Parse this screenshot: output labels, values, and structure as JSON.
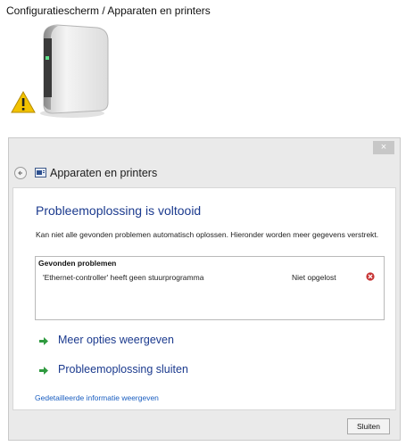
{
  "breadcrumb": "Configuratiescherm / Apparaten en printers",
  "device": {
    "icon": "network-adapter-warning-icon"
  },
  "dialog": {
    "close_label": "×",
    "nav_title": "Apparaten en printers",
    "heading": "Probleemoplossing is voltooid",
    "description": "Kan niet alle gevonden problemen automatisch oplossen. Hieronder worden meer gegevens verstrekt.",
    "problems_header": "Gevonden problemen",
    "problems": [
      {
        "description": "'Ethernet-controller' heeft geen stuurprogramma",
        "status": "Niet opgelost",
        "status_icon": "error-icon"
      }
    ],
    "options": [
      {
        "label": "Meer opties weergeven",
        "icon": "green-arrow-icon"
      },
      {
        "label": "Probleemoplossing sluiten",
        "icon": "green-arrow-icon"
      }
    ],
    "details_link": "Gedetailleerde informatie weergeven",
    "primary_button": "Sluiten"
  },
  "colors": {
    "heading": "#1b3a8e",
    "link": "#1a5ec0",
    "arrow": "#2f9a3f",
    "error": "#c73434",
    "dialog_bg": "#eaeaea"
  }
}
